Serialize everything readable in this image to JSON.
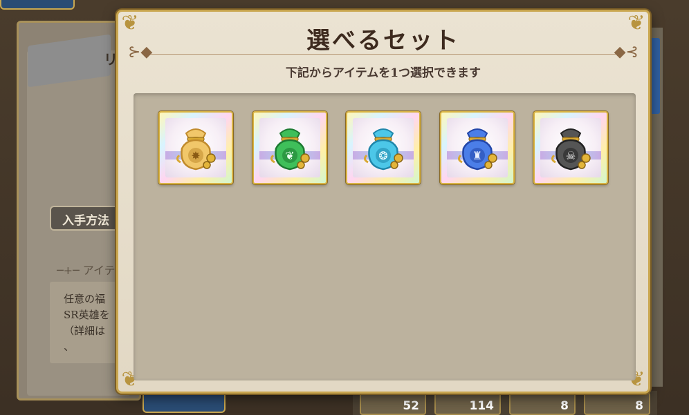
{
  "modal": {
    "title": "選べるセット",
    "subtitle": "下記からアイテムを1つ選択できます",
    "items": [
      {
        "name": "gold-bag",
        "emblem": "sun-emblem-icon",
        "bag_color": "#f1c76a",
        "bag_dark": "#c08a2c",
        "emblem_color": "#8a5a14"
      },
      {
        "name": "green-bag",
        "emblem": "leaf-emblem-icon",
        "bag_color": "#3fbf5a",
        "bag_dark": "#1d7a32",
        "emblem_color": "#e8fff0"
      },
      {
        "name": "cyan-bag",
        "emblem": "water-emblem-icon",
        "bag_color": "#4cc7e8",
        "bag_dark": "#1f86aa",
        "emblem_color": "#eafcff"
      },
      {
        "name": "blue-bag",
        "emblem": "helmet-emblem-icon",
        "bag_color": "#4b7ee8",
        "bag_dark": "#2346a8",
        "emblem_color": "#eaf1ff"
      },
      {
        "name": "black-bag",
        "emblem": "skull-emblem-icon",
        "bag_color": "#555555",
        "bag_dark": "#222222",
        "emblem_color": "#f2f2f2"
      }
    ]
  },
  "background": {
    "ribbon_text": "リ",
    "acquire_button": "入手方法",
    "section_heading": "─+─ アイテ",
    "description": "任意の福\nSR英雄を\n（詳細は\n、",
    "slot_counts": [
      "52",
      "114",
      "8",
      "8"
    ]
  }
}
